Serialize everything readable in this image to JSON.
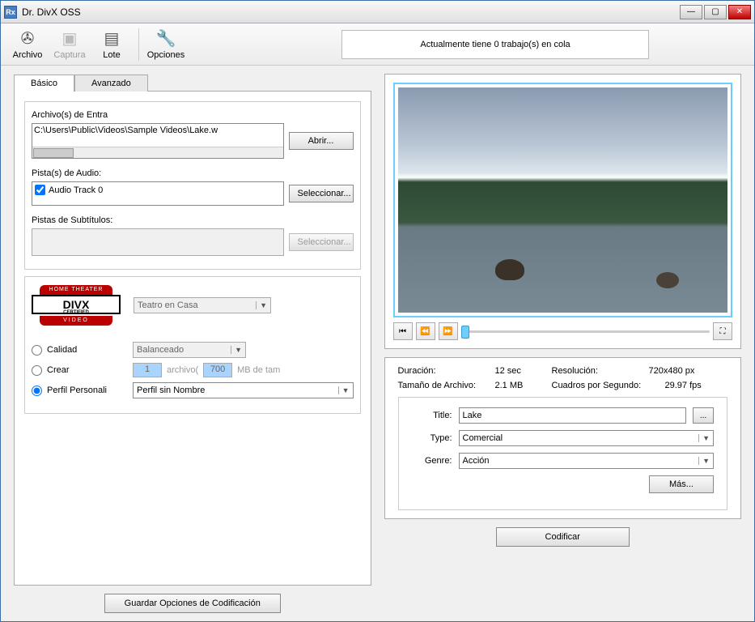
{
  "window": {
    "title": "Dr. DivX OSS"
  },
  "toolbar": {
    "archivo": "Archivo",
    "captura": "Captura",
    "lote": "Lote",
    "opciones": "Opciones",
    "queue_status": "Actualmente tiene 0 trabajo(s) en cola"
  },
  "tabs": {
    "basico": "Básico",
    "avanzado": "Avanzado"
  },
  "input": {
    "files_label": "Archivo(s) de Entra",
    "file_path": "C:\\Users\\Public\\Videos\\Sample Videos\\Lake.w",
    "abrir": "Abrir...",
    "audio_label": "Pista(s) de Audio:",
    "audio_track": "Audio Track 0",
    "seleccionar": "Seleccionar...",
    "subs_label": "Pistas de Subtítulos:"
  },
  "divx": {
    "logo_top": "HOME THEATER",
    "logo_mid": "DIVX",
    "logo_cert": "CERTIFIED",
    "logo_bot": "VIDEO",
    "profile": "Teatro en Casa"
  },
  "encode": {
    "calidad": "Calidad",
    "balanceado": "Balanceado",
    "crear": "Crear",
    "num_files": "1",
    "archivo": "archivo(",
    "size_mb": "700",
    "mb_de_tam": "MB de tam",
    "perfil_personal": "Perfil Personali",
    "perfil_sin_nombre": "Perfil sin Nombre"
  },
  "preview": {
    "duracion_l": "Duración:",
    "duracion_v": "12 sec",
    "tamano_l": "Tamaño de Archivo:",
    "tamano_v": "2.1 MB",
    "resolucion_l": "Resolución:",
    "resolucion_v": "720x480 px",
    "fps_l": "Cuadros por Segundo:",
    "fps_v": "29.97 fps"
  },
  "meta": {
    "title_l": "Title:",
    "title_v": "Lake",
    "type_l": "Type:",
    "type_v": "Comercial",
    "genre_l": "Genre:",
    "genre_v": "Acción",
    "mas": "Más..."
  },
  "buttons": {
    "guardar": "Guardar Opciones de Codificación",
    "codificar": "Codificar"
  }
}
